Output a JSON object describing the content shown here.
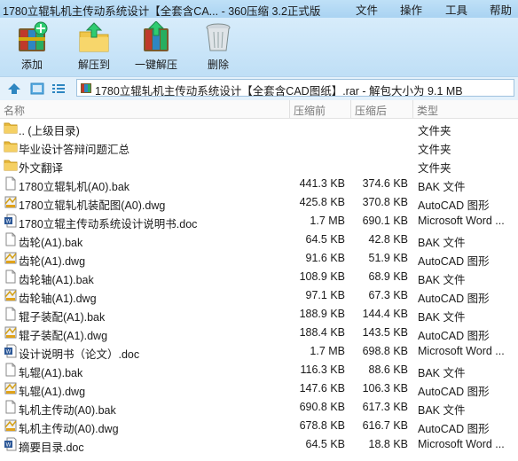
{
  "window": {
    "title": "1780立辊轧机主传动系统设计【全套含CA... - 360压缩 3.2正式版",
    "menu": [
      "文件",
      "操作",
      "工具",
      "帮助"
    ]
  },
  "toolbar": {
    "buttons": [
      {
        "label": "添加",
        "icon": "add-archive-icon"
      },
      {
        "label": "解压到",
        "icon": "extract-folder-icon"
      },
      {
        "label": "一键解压",
        "icon": "one-click-extract-icon"
      },
      {
        "label": "删除",
        "icon": "delete-trash-icon"
      }
    ]
  },
  "pathbar": {
    "path": "1780立辊轧机主传动系统设计【全套含CAD图纸】.rar - 解包大小为 9.1 MB"
  },
  "columns": {
    "name": "名称",
    "packed": "压缩前",
    "unpacked": "压缩后",
    "type": "类型"
  },
  "files": [
    {
      "name": ".. (上级目录)",
      "packed": "",
      "unpacked": "",
      "type": "文件夹",
      "icon": "folder"
    },
    {
      "name": "毕业设计答辩问题汇总",
      "packed": "",
      "unpacked": "",
      "type": "文件夹",
      "icon": "folder"
    },
    {
      "name": "外文翻译",
      "packed": "",
      "unpacked": "",
      "type": "文件夹",
      "icon": "folder"
    },
    {
      "name": "1780立辊轧机(A0).bak",
      "packed": "441.3 KB",
      "unpacked": "374.6 KB",
      "type": "BAK 文件",
      "icon": "bak"
    },
    {
      "name": "1780立辊轧机装配图(A0).dwg",
      "packed": "425.8 KB",
      "unpacked": "370.8 KB",
      "type": "AutoCAD 图形",
      "icon": "dwg"
    },
    {
      "name": "1780立辊主传动系统设计说明书.doc",
      "packed": "1.7 MB",
      "unpacked": "690.1 KB",
      "type": "Microsoft Word ...",
      "icon": "doc"
    },
    {
      "name": "齿轮(A1).bak",
      "packed": "64.5 KB",
      "unpacked": "42.8 KB",
      "type": "BAK 文件",
      "icon": "bak"
    },
    {
      "name": "齿轮(A1).dwg",
      "packed": "91.6 KB",
      "unpacked": "51.9 KB",
      "type": "AutoCAD 图形",
      "icon": "dwg"
    },
    {
      "name": "齿轮轴(A1).bak",
      "packed": "108.9 KB",
      "unpacked": "68.9 KB",
      "type": "BAK 文件",
      "icon": "bak"
    },
    {
      "name": "齿轮轴(A1).dwg",
      "packed": "97.1 KB",
      "unpacked": "67.3 KB",
      "type": "AutoCAD 图形",
      "icon": "dwg"
    },
    {
      "name": "辊子装配(A1).bak",
      "packed": "188.9 KB",
      "unpacked": "144.4 KB",
      "type": "BAK 文件",
      "icon": "bak"
    },
    {
      "name": "辊子装配(A1).dwg",
      "packed": "188.4 KB",
      "unpacked": "143.5 KB",
      "type": "AutoCAD 图形",
      "icon": "dwg"
    },
    {
      "name": "设计说明书（论文）.doc",
      "packed": "1.7 MB",
      "unpacked": "698.8 KB",
      "type": "Microsoft Word ...",
      "icon": "doc"
    },
    {
      "name": "轧辊(A1).bak",
      "packed": "116.3 KB",
      "unpacked": "88.6 KB",
      "type": "BAK 文件",
      "icon": "bak"
    },
    {
      "name": "轧辊(A1).dwg",
      "packed": "147.6 KB",
      "unpacked": "106.3 KB",
      "type": "AutoCAD 图形",
      "icon": "dwg"
    },
    {
      "name": "轧机主传动(A0).bak",
      "packed": "690.8 KB",
      "unpacked": "617.3 KB",
      "type": "BAK 文件",
      "icon": "bak"
    },
    {
      "name": "轧机主传动(A0).dwg",
      "packed": "678.8 KB",
      "unpacked": "616.7 KB",
      "type": "AutoCAD 图形",
      "icon": "dwg"
    },
    {
      "name": "摘要目录.doc",
      "packed": "64.5 KB",
      "unpacked": "18.8 KB",
      "type": "Microsoft Word ...",
      "icon": "doc"
    }
  ],
  "colors": {
    "titlebar": "#bfe0f7",
    "toolbar": "#cfe8fa",
    "folder": "#f0c64a",
    "word": "#2b5797",
    "accent": "#1e74c8"
  }
}
